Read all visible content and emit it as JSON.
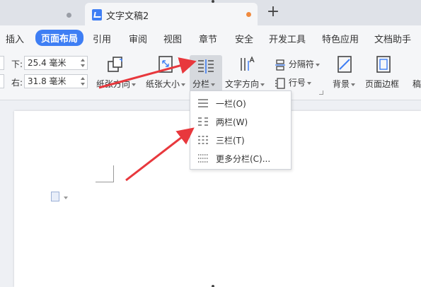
{
  "tabs": {
    "active_title": "文字文稿2",
    "add_symbol": "+"
  },
  "menu": {
    "items": [
      "插入",
      "页面布局",
      "引用",
      "审阅",
      "视图",
      "章节",
      "安全",
      "开发工具",
      "特色应用",
      "文档助手"
    ],
    "active": "页面布局"
  },
  "ribbon": {
    "margin_bottom_label": "下:",
    "margin_bottom_value": "25.4 毫米",
    "margin_right_label": "右:",
    "margin_right_value": "31.8 毫米",
    "orientation_label": "纸张方向",
    "size_label": "纸张大小",
    "columns_label": "分栏",
    "text_direction_label": "文字方向",
    "separator_label": "分隔符",
    "line_number_label": "行号",
    "background_label": "背景",
    "page_border_label": "页面边框",
    "truncated_label": "稿"
  },
  "columns_menu": {
    "items": [
      "一栏(O)",
      "两栏(W)",
      "三栏(T)",
      "更多分栏(C)..."
    ]
  },
  "colors": {
    "accent": "#3e7ef4",
    "annotation_arrow": "#e8383d",
    "modified_dot": "#f08a3e"
  }
}
